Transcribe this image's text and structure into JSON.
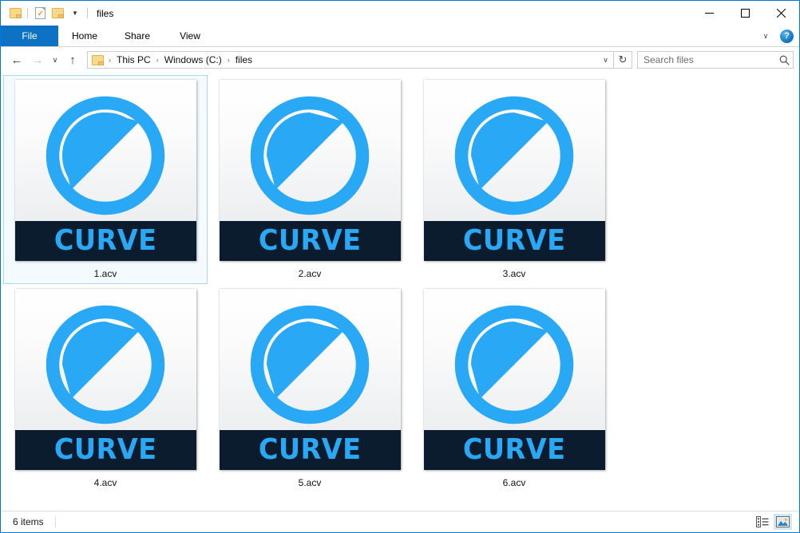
{
  "window": {
    "title": "files",
    "quick_access": [
      {
        "name": "folder-icon",
        "label": "Folder"
      },
      {
        "name": "properties-icon",
        "label": "Properties"
      },
      {
        "name": "new-folder-icon",
        "label": "New folder"
      },
      {
        "name": "customize-caret-icon",
        "label": "Customize Quick Access Toolbar"
      }
    ],
    "controls": {
      "minimize": "─",
      "maximize": "☐",
      "close": "✕"
    }
  },
  "ribbon": {
    "tabs": [
      {
        "label": "File",
        "active": true
      },
      {
        "label": "Home",
        "active": false
      },
      {
        "label": "Share",
        "active": false
      },
      {
        "label": "View",
        "active": false
      }
    ],
    "expand_caret": "∨",
    "help_label": "?"
  },
  "nav": {
    "back": "←",
    "forward": "→",
    "recent": "∨",
    "up": "↑",
    "breadcrumb": [
      "This PC",
      "Windows (C:)",
      "files"
    ],
    "separator": "›",
    "dropdown_caret": "∨",
    "refresh": "↻"
  },
  "search": {
    "placeholder": "Search files",
    "value": ""
  },
  "files": [
    {
      "name": "1.acv",
      "badge": "CURVE",
      "selected": true
    },
    {
      "name": "2.acv",
      "badge": "CURVE",
      "selected": false
    },
    {
      "name": "3.acv",
      "badge": "CURVE",
      "selected": false
    },
    {
      "name": "4.acv",
      "badge": "CURVE",
      "selected": false
    },
    {
      "name": "5.acv",
      "badge": "CURVE",
      "selected": false
    },
    {
      "name": "6.acv",
      "badge": "CURVE",
      "selected": false
    }
  ],
  "status": {
    "item_count": "6 items"
  },
  "view_toggle": {
    "details_label": "Details view",
    "large_icons_label": "Large icons view",
    "active": "large-icons"
  },
  "colors": {
    "accent_blue": "#0078d7",
    "file_tab_blue": "#0d72c4",
    "icon_blue": "#29a8f5",
    "band_navy": "#0b1c2e",
    "selection_border": "#a8d8f0",
    "selection_fill": "#f4fafe"
  }
}
